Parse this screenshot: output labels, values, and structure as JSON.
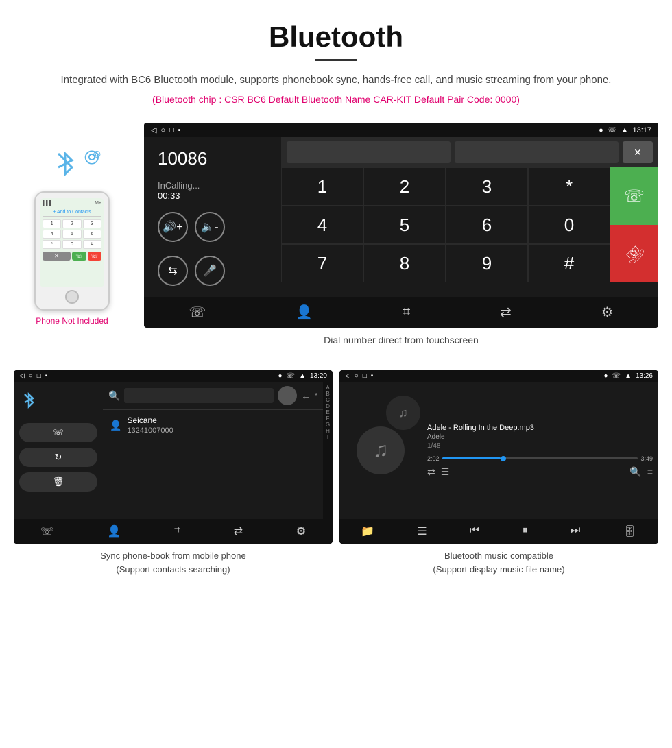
{
  "header": {
    "title": "Bluetooth",
    "description": "Integrated with BC6 Bluetooth module, supports phonebook sync, hands-free call, and music streaming from your phone.",
    "specs": "(Bluetooth chip : CSR BC6    Default Bluetooth Name CAR-KIT    Default Pair Code: 0000)"
  },
  "phone_illustration": {
    "not_included_label": "Phone Not Included"
  },
  "dial_screen": {
    "status_time": "13:17",
    "dialed_number": "10086",
    "call_status": "InCalling...",
    "call_timer": "00:33",
    "numpad_keys": [
      "1",
      "2",
      "3",
      "*",
      "4",
      "5",
      "6",
      "0",
      "7",
      "8",
      "9",
      "#"
    ],
    "caption": "Dial number direct from touchscreen"
  },
  "phonebook_screen": {
    "status_time": "13:20",
    "contact_name": "Seicane",
    "contact_number": "13241007000",
    "alpha_letters": [
      "A",
      "B",
      "C",
      "D",
      "E",
      "F",
      "G",
      "H",
      "I"
    ],
    "caption": "Sync phone-book from mobile phone\n(Support contacts searching)"
  },
  "music_screen": {
    "status_time": "13:26",
    "track_name": "Adele - Rolling In the Deep.mp3",
    "artist": "Adele",
    "track_count": "1/48",
    "time_current": "2:02",
    "time_total": "3:49",
    "progress_percent": 30,
    "caption": "Bluetooth music compatible\n(Support display music file name)"
  },
  "colors": {
    "accent_pink": "#e0006e",
    "accent_blue": "#5ab4e8",
    "green": "#4CAF50",
    "red": "#d32f2f"
  }
}
